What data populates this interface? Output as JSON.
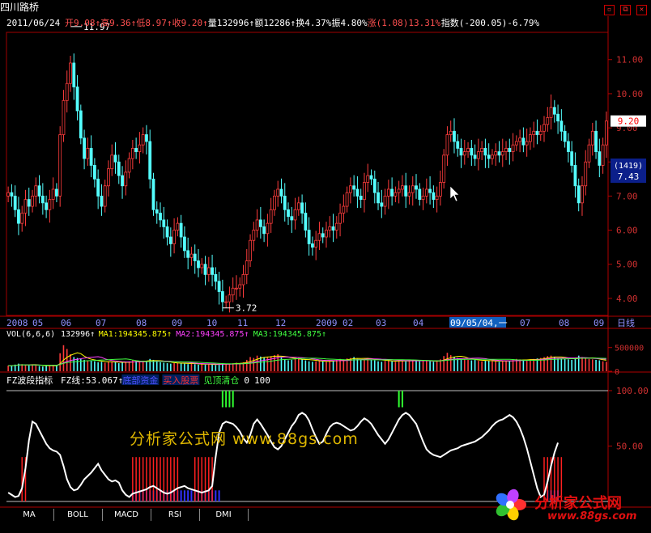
{
  "stock": {
    "name": "四川路桥",
    "date": "2011/06/24"
  },
  "quote": [
    {
      "text": "开9.08↑",
      "color": "#ff5050"
    },
    {
      "text": "高9.36↑",
      "color": "#ff5050"
    },
    {
      "text": "低8.97↑",
      "color": "#ff5050"
    },
    {
      "text": "收9.20↑",
      "color": "#ff5050"
    },
    {
      "text": "量132996↑",
      "color": "#ffffff"
    },
    {
      "text": "额12286↑",
      "color": "#ffffff"
    },
    {
      "text": "换4.37%",
      "color": "#ffffff"
    },
    {
      "text": "振4.80%",
      "color": "#ffffff"
    },
    {
      "text": "涨(1.08)13.31%",
      "color": "#ff5050"
    },
    {
      "text": "指数(-200.05)-6.79%",
      "color": "#ffffff"
    }
  ],
  "toolbar": {
    "icons": [
      {
        "name": "shrink-icon",
        "glyph": "▫"
      },
      {
        "name": "restore-icon",
        "glyph": "⧉"
      },
      {
        "name": "close-icon",
        "glyph": "✕"
      }
    ]
  },
  "chart_data": [
    {
      "type": "candlestick",
      "title": "四川路桥",
      "ylim": [
        3.5,
        11.8
      ],
      "yticks": [
        4.0,
        5.0,
        6.0,
        7.0,
        8.0,
        9.0,
        10.0,
        11.0
      ],
      "ytick_labels": [
        "4.00",
        "5.00",
        "6.00",
        "7.00",
        "8.00",
        "9.00",
        "10.00",
        "11.00"
      ],
      "x_labels": [
        "2008",
        "05",
        "06",
        "07",
        "08",
        "09",
        "10",
        "11",
        "12",
        "2009",
        "02",
        "03",
        "04",
        "09/05/04,一",
        "07",
        "08",
        "09",
        "日线"
      ],
      "high_annotation": "11.97",
      "low_annotation": "3.72",
      "price_tag": "9.20",
      "crosshair_labels": [
        "(1419)",
        "7.43"
      ],
      "close": [
        7.1,
        7.0,
        6.6,
        6.2,
        6.5,
        6.9,
        6.7,
        7.0,
        7.3,
        7.0,
        6.8,
        6.6,
        6.9,
        7.2,
        7.0,
        8.8,
        9.8,
        10.3,
        10.9,
        10.2,
        9.5,
        8.7,
        8.1,
        8.4,
        7.9,
        7.5,
        7.0,
        6.7,
        7.3,
        7.8,
        8.2,
        8.0,
        7.6,
        7.3,
        7.7,
        8.1,
        8.4,
        8.3,
        8.5,
        8.8,
        8.6,
        7.5,
        6.6,
        6.5,
        6.3,
        6.1,
        5.8,
        5.6,
        6.0,
        6.2,
        5.8,
        5.4,
        5.2,
        5.3,
        5.1,
        4.9,
        5.0,
        4.7,
        4.9,
        4.7,
        4.5,
        4.2,
        3.9,
        3.9,
        4.1,
        4.3,
        4.3,
        4.4,
        4.7,
        5.1,
        5.7,
        6.0,
        6.3,
        6.1,
        5.9,
        6.2,
        6.6,
        7.0,
        7.2,
        7.0,
        6.6,
        6.4,
        6.3,
        6.6,
        6.8,
        6.5,
        6.0,
        5.6,
        5.5,
        5.7,
        5.9,
        5.8,
        6.0,
        6.1,
        6.0,
        6.2,
        6.5,
        6.7,
        7.1,
        7.3,
        7.2,
        7.0,
        6.9,
        7.4,
        7.6,
        7.5,
        7.1,
        6.8,
        6.7,
        7.0,
        7.2,
        7.0,
        7.1,
        7.2,
        7.3,
        7.0,
        7.1,
        7.3,
        7.2,
        6.9,
        7.0,
        7.2,
        7.1,
        6.9,
        7.0,
        7.4,
        8.2,
        8.8,
        8.9,
        8.6,
        8.4,
        8.2,
        8.3,
        8.4,
        8.2,
        8.1,
        8.3,
        8.4,
        8.2,
        8.1,
        8.2,
        8.3,
        8.2,
        8.3,
        8.4,
        8.3,
        8.5,
        8.6,
        8.7,
        8.5,
        8.6,
        8.8,
        8.9,
        8.8,
        8.9,
        9.1,
        9.3,
        9.6,
        9.4,
        9.2,
        8.9,
        8.6,
        8.3,
        7.9,
        7.3,
        6.8,
        7.3,
        8.0,
        8.5,
        8.9,
        8.3,
        7.9,
        8.5,
        9.2
      ]
    },
    {
      "type": "bar",
      "title": "VOL(6,6,6)",
      "legend": [
        {
          "text": "132996↑",
          "color": "#ffffff"
        },
        {
          "text": "MA1:194345.875↑",
          "color": "#ffff00"
        },
        {
          "text": "MA2:194345.875↑",
          "color": "#ff40ff"
        },
        {
          "text": "MA3:194345.875↑",
          "color": "#40ff40"
        }
      ],
      "ylim": [
        0,
        700000
      ],
      "yticks": [
        0,
        500000
      ],
      "ytick_labels": [
        "0",
        "500000"
      ],
      "values": [
        120000,
        110000,
        140000,
        160000,
        150000,
        130000,
        120000,
        130000,
        140000,
        110000,
        100000,
        120000,
        110000,
        130000,
        120000,
        380000,
        550000,
        470000,
        360000,
        300000,
        280000,
        260000,
        240000,
        230000,
        220000,
        210000,
        190000,
        200000,
        180000,
        210000,
        200000,
        190000,
        170000,
        180000,
        190000,
        210000,
        230000,
        220000,
        210000,
        220000,
        200000,
        260000,
        240000,
        220000,
        190000,
        180000,
        170000,
        160000,
        170000,
        180000,
        170000,
        160000,
        150000,
        160000,
        150000,
        140000,
        150000,
        140000,
        150000,
        140000,
        130000,
        160000,
        170000,
        150000,
        160000,
        170000,
        180000,
        170000,
        190000,
        240000,
        300000,
        280000,
        330000,
        310000,
        290000,
        300000,
        320000,
        340000,
        360000,
        300000,
        250000,
        230000,
        240000,
        260000,
        280000,
        250000,
        230000,
        210000,
        200000,
        210000,
        220000,
        210000,
        200000,
        220000,
        230000,
        240000,
        260000,
        250000,
        270000,
        280000,
        300000,
        260000,
        250000,
        260000,
        280000,
        250000,
        230000,
        210000,
        200000,
        220000,
        240000,
        210000,
        200000,
        230000,
        220000,
        210000,
        240000,
        230000,
        220000,
        210000,
        230000,
        220000,
        210000,
        200000,
        210000,
        250000,
        320000,
        390000,
        340000,
        300000,
        280000,
        260000,
        250000,
        240000,
        230000,
        240000,
        220000,
        210000,
        230000,
        220000,
        210000,
        220000,
        200000,
        210000,
        230000,
        220000,
        240000,
        260000,
        250000,
        240000,
        230000,
        250000,
        260000,
        270000,
        280000,
        300000,
        320000,
        330000,
        300000,
        280000,
        270000,
        260000,
        250000,
        240000,
        280000,
        330000,
        300000,
        270000,
        260000,
        250000,
        240000,
        230000,
        210000,
        200000
      ]
    },
    {
      "type": "line",
      "title": "FZ波段指标",
      "legend": [
        {
          "text": "FZ线:53.067↑",
          "color": "#ffffff"
        },
        {
          "text": "底部资金",
          "color": "#5050ff"
        },
        {
          "text": "买入股票",
          "color": "#ff3030"
        },
        {
          "text": "见顶清仓",
          "color": "#40ff40"
        },
        {
          "text": "0",
          "color": "#ffffff"
        },
        {
          "text": "100",
          "color": "#ffffff"
        }
      ],
      "ylim": [
        0,
        108
      ],
      "yticks": [
        50,
        100
      ],
      "ytick_labels": [
        "50.00",
        "100.00"
      ],
      "values": [
        8,
        6,
        4,
        5,
        12,
        30,
        55,
        72,
        70,
        64,
        58,
        52,
        48,
        46,
        45,
        42,
        32,
        20,
        13,
        10,
        11,
        15,
        20,
        23,
        26,
        30,
        34,
        28,
        24,
        20,
        18,
        19,
        17,
        10,
        6,
        4,
        7,
        8,
        9,
        10,
        11,
        13,
        14,
        12,
        10,
        8,
        7,
        8,
        10,
        12,
        13,
        14,
        12,
        11,
        10,
        9,
        8,
        9,
        10,
        14,
        40,
        62,
        70,
        72,
        71,
        70,
        67,
        63,
        57,
        53,
        60,
        70,
        74,
        70,
        65,
        60,
        54,
        49,
        47,
        50,
        56,
        62,
        68,
        72,
        78,
        80,
        78,
        73,
        65,
        58,
        52,
        54,
        61,
        67,
        70,
        71,
        70,
        68,
        66,
        64,
        65,
        68,
        72,
        75,
        73,
        70,
        65,
        60,
        56,
        52,
        56,
        62,
        68,
        74,
        78,
        80,
        78,
        74,
        70,
        62,
        54,
        47,
        44,
        42,
        41,
        40,
        42,
        44,
        46,
        47,
        48,
        50,
        51,
        52,
        53,
        54,
        56,
        58,
        61,
        64,
        68,
        71,
        73,
        74,
        76,
        78,
        76,
        72,
        66,
        58,
        48,
        36,
        24,
        12,
        4,
        6,
        18,
        32,
        44,
        53
      ],
      "top_marks": [
        62,
        63,
        64,
        65,
        113,
        114
      ],
      "buy_marks": [
        4,
        5,
        36,
        37,
        38,
        39,
        40,
        41,
        42,
        43,
        44,
        45,
        46,
        47,
        48,
        49,
        54,
        55,
        56,
        57,
        58,
        59,
        155,
        156,
        157,
        158,
        159,
        160
      ],
      "bottom_marks": [
        36,
        37,
        38,
        39,
        40,
        41,
        42,
        43,
        44,
        45,
        46,
        47,
        48,
        49,
        50,
        51,
        52,
        53,
        54,
        55,
        56,
        57,
        58,
        59,
        60,
        61,
        156,
        157,
        158,
        159
      ]
    }
  ],
  "tabs": [
    "MA",
    "BOLL",
    "MACD",
    "RSI",
    "DMI"
  ],
  "watermark": {
    "text": "分析家公式网 www.88gs.com",
    "logo_text": "分析家公式网",
    "logo_url": "www.88gs.com"
  }
}
